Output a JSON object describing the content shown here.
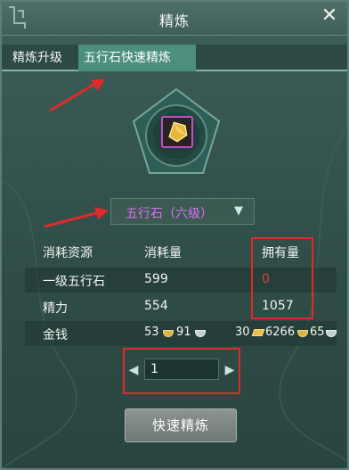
{
  "window": {
    "title": "精炼",
    "close_glyph": "✕"
  },
  "tabs": [
    {
      "label": "精炼升级"
    },
    {
      "label": "五行石快速精炼"
    }
  ],
  "item": {
    "icon": "five-element-stone-icon"
  },
  "selector": {
    "selected": "五行石（六级）",
    "arrow": "▼"
  },
  "table": {
    "headers": [
      "消耗资源",
      "消耗量",
      "拥有量"
    ],
    "rows": [
      {
        "resource": "一级五行石",
        "cost": "599",
        "owned": "0"
      },
      {
        "resource": "精力",
        "cost": "554",
        "owned": "1057"
      }
    ],
    "money_row": {
      "label": "金钱",
      "cost_gold": "53",
      "cost_silver": "91",
      "owned_ingot": "30",
      "owned_gold": "6266",
      "owned_silver": "65"
    }
  },
  "stepper": {
    "value": "1",
    "left_glyph": "◀",
    "right_glyph": "▶"
  },
  "buttons": {
    "quick_refine": "快速精炼"
  },
  "colors": {
    "selected_text": "#e06ef6",
    "active_tab": "#4b8f7c",
    "annotation_red": "#e02a2a",
    "zero_value": "#e0423c"
  }
}
